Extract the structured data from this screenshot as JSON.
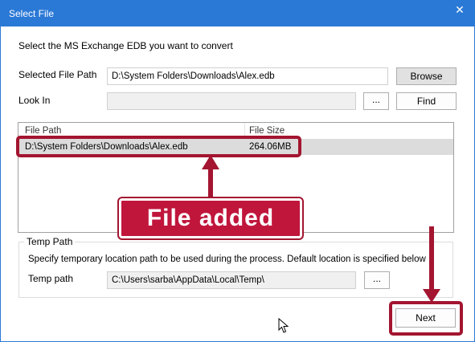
{
  "window": {
    "title": "Select File",
    "close_glyph": "✕"
  },
  "instructions": "Select the MS Exchange EDB you want to convert",
  "selected_file_path": {
    "label": "Selected File Path",
    "value": "D:\\System Folders\\Downloads\\Alex.edb",
    "browse_label": "Browse"
  },
  "look_in": {
    "label": "Look In",
    "value": "",
    "ellipsis_label": "...",
    "find_label": "Find"
  },
  "file_list": {
    "columns": [
      "File Path",
      "File Size"
    ],
    "rows": [
      {
        "path": "D:\\System Folders\\Downloads\\Alex.edb",
        "size": "264.06MB"
      }
    ]
  },
  "temp_group": {
    "legend": "Temp Path",
    "description": "Specify temporary location path to be used during the process. Default location is specified below :",
    "label": "Temp path",
    "value": "C:\\Users\\sarba\\AppData\\Local\\Temp\\",
    "ellipsis_label": "..."
  },
  "next_label": "Next",
  "annotation": {
    "text": "File added",
    "color": "#c0163c"
  },
  "colors": {
    "titlebar": "#2b79d6",
    "highlight": "#a31530"
  },
  "icons": [
    "close-icon",
    "mouse-cursor-icon"
  ]
}
